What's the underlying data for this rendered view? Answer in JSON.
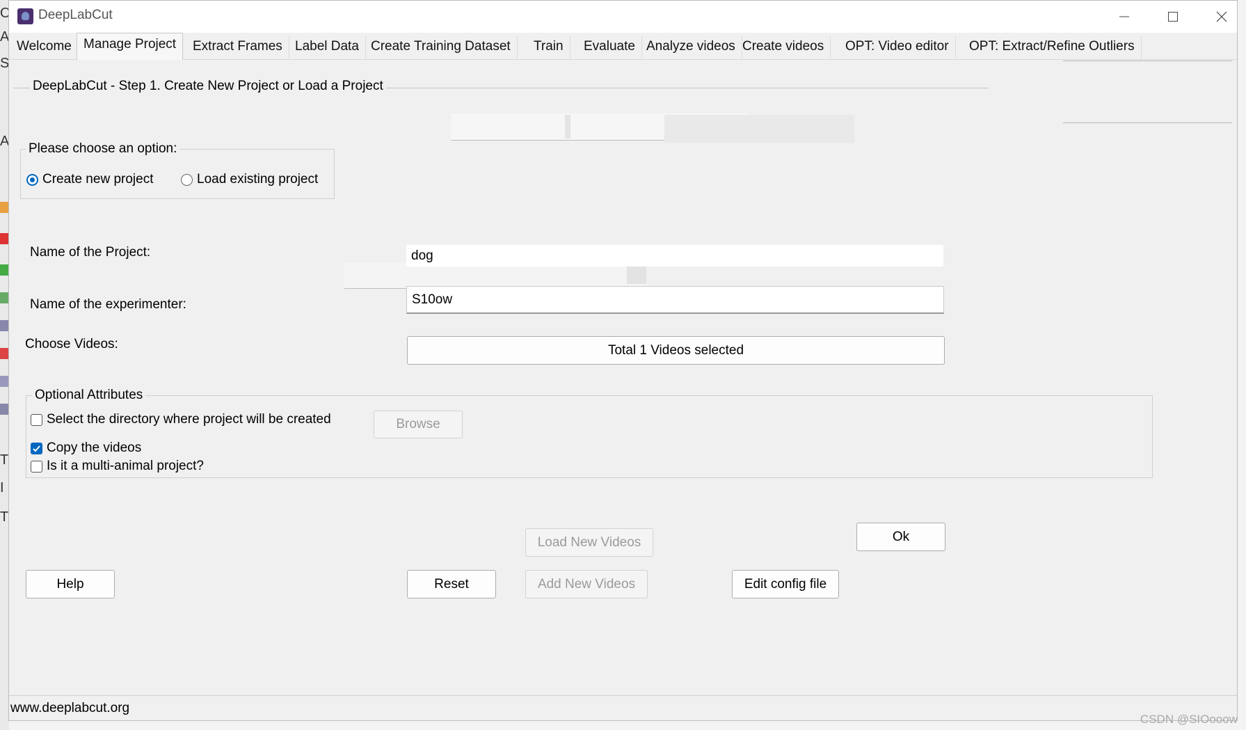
{
  "window": {
    "title": "DeepLabCut",
    "icon": "deeplabcut-logo-icon"
  },
  "tabs": [
    {
      "label": "Welcome"
    },
    {
      "label": "Manage Project",
      "active": true
    },
    {
      "label": "Extract Frames"
    },
    {
      "label": "Label Data"
    },
    {
      "label": "Create Training Dataset"
    },
    {
      "label": "Train"
    },
    {
      "label": "Evaluate"
    },
    {
      "label": "Analyze videos"
    },
    {
      "label": "Create videos"
    },
    {
      "label": "OPT: Video editor"
    },
    {
      "label": "OPT: Extract/Refine Outliers"
    }
  ],
  "step_title": "DeepLabCut - Step 1. Create New Project or Load a Project",
  "options": {
    "title": "Please choose an option:",
    "create_label": "Create new project",
    "load_label": "Load existing project",
    "selected": "create"
  },
  "form": {
    "project_name_label": "Name of the Project:",
    "project_name_value": "dog",
    "experimenter_label": "Name of the experimenter:",
    "experimenter_value": "S10ow",
    "videos_label": "Choose Videos:",
    "videos_button": "Total 1 Videos selected"
  },
  "optional": {
    "title": "Optional Attributes",
    "select_dir_label": "Select the directory where project will be created",
    "select_dir_checked": false,
    "browse_label": "Browse",
    "copy_videos_label": "Copy the videos",
    "copy_videos_checked": true,
    "multi_animal_label": "Is it a multi-animal project?",
    "multi_animal_checked": false
  },
  "buttons": {
    "load_new_videos": "Load New Videos",
    "ok": "Ok",
    "help": "Help",
    "reset": "Reset",
    "add_new_videos": "Add New Videos",
    "edit_config": "Edit config file"
  },
  "status": "www.deeplabcut.org",
  "watermark": "CSDN @SIOooow"
}
